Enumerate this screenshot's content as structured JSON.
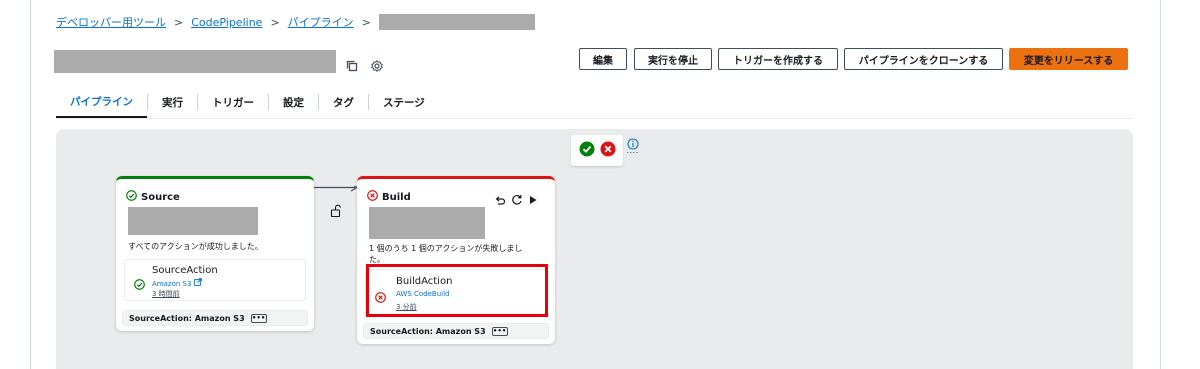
{
  "breadcrumb": {
    "items": [
      "デベロッパー用ツール",
      "CodePipeline",
      "パイプライン"
    ],
    "separator": ">"
  },
  "toolbar": {
    "edit_label": "編集",
    "stop_label": "実行を停止",
    "create_trigger_label": "トリガーを作成する",
    "clone_label": "パイプラインをクローンする",
    "release_label": "変更をリリースする"
  },
  "tabs": [
    {
      "label": "パイプライン",
      "active": true
    },
    {
      "label": "実行",
      "active": false
    },
    {
      "label": "トリガー",
      "active": false
    },
    {
      "label": "設定",
      "active": false
    },
    {
      "label": "タグ",
      "active": false
    },
    {
      "label": "ステージ",
      "active": false
    }
  ],
  "legend": {
    "icons": [
      "success-icon",
      "failed-icon",
      "info-icon"
    ]
  },
  "stages": {
    "source": {
      "name": "Source",
      "status": "succeeded",
      "message": "すべてのアクションが成功しました。",
      "action": {
        "name": "SourceAction",
        "provider": "Amazon S3",
        "time": "3 時間前"
      },
      "footer": "SourceAction: Amazon S3"
    },
    "build": {
      "name": "Build",
      "status": "failed",
      "message_line1": "1 個のうち 1 個のアクションが失敗しまし",
      "message_line2": "た。",
      "action": {
        "name": "BuildAction",
        "provider": "AWS CodeBuild",
        "time": "3 分前"
      },
      "footer": "SourceAction: Amazon S3"
    }
  },
  "colors": {
    "link": "#0972d3",
    "primary_button": "#ec7211",
    "success": "#037f0c",
    "error": "#d91515",
    "highlight_box": "#e5000a"
  }
}
